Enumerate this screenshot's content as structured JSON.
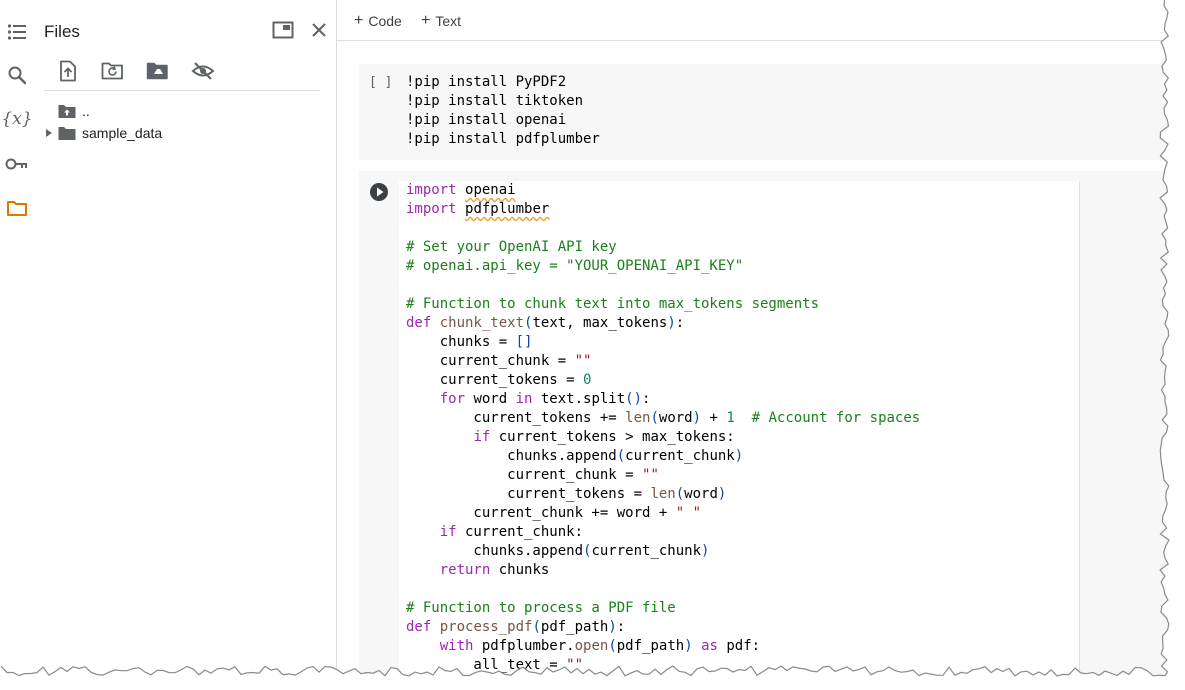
{
  "rail": {
    "items": [
      {
        "name": "table-of-contents-icon",
        "active": false
      },
      {
        "name": "search-icon",
        "active": false
      },
      {
        "name": "variables-icon",
        "label": "{x}",
        "active": false
      },
      {
        "name": "secrets-key-icon",
        "active": false
      },
      {
        "name": "files-folder-icon",
        "active": true
      }
    ],
    "active_color": "#e37400",
    "icon_color": "#5f6368"
  },
  "files": {
    "title": "Files",
    "header_buttons": [
      "open-in-tab-icon",
      "close-icon"
    ],
    "toolbar": [
      "upload-file-icon",
      "refresh-folder-icon",
      "mount-drive-icon",
      "hide-files-icon"
    ],
    "tree": [
      {
        "label": "..",
        "type": "parent-folder"
      },
      {
        "label": "sample_data",
        "type": "folder",
        "collapsed": true
      }
    ]
  },
  "toolbar": {
    "code_label": "Code",
    "text_label": "Text",
    "plus": "+"
  },
  "cell1": {
    "bracket": "[ ]",
    "lines": [
      "!pip install PyPDF2",
      "!pip install tiktoken",
      "!pip install openai",
      "!pip install pdfplumber"
    ]
  },
  "cell2": {
    "run_icon": "play-circle-icon",
    "lines": [
      "import openai",
      "import pdfplumber",
      "",
      "# Set your OpenAI API key",
      "# openai.api_key = \"YOUR_OPENAI_API_KEY\"",
      "",
      "# Function to chunk text into max_tokens segments",
      "def chunk_text(text, max_tokens):",
      "    chunks = []",
      "    current_chunk = \"\"",
      "    current_tokens = 0",
      "    for word in text.split():",
      "        current_tokens += len(word) + 1  # Account for spaces",
      "        if current_tokens > max_tokens:",
      "            chunks.append(current_chunk)",
      "            current_chunk = \"\"",
      "            current_tokens = len(word)",
      "        current_chunk += word + \" \"",
      "    if current_chunk:",
      "        chunks.append(current_chunk)",
      "    return chunks",
      "",
      "# Function to process a PDF file",
      "def process_pdf(pdf_path):",
      "    with pdfplumber.open(pdf_path) as pdf:",
      "        all_text = \"\""
    ]
  },
  "colors": {
    "keyword": "#9c27b0",
    "function": "#795548",
    "comment": "#1b7f1b",
    "string": "#a31515",
    "number": "#098658",
    "cell_bg": "#f7f7f7",
    "panel_border": "#dadce0"
  }
}
